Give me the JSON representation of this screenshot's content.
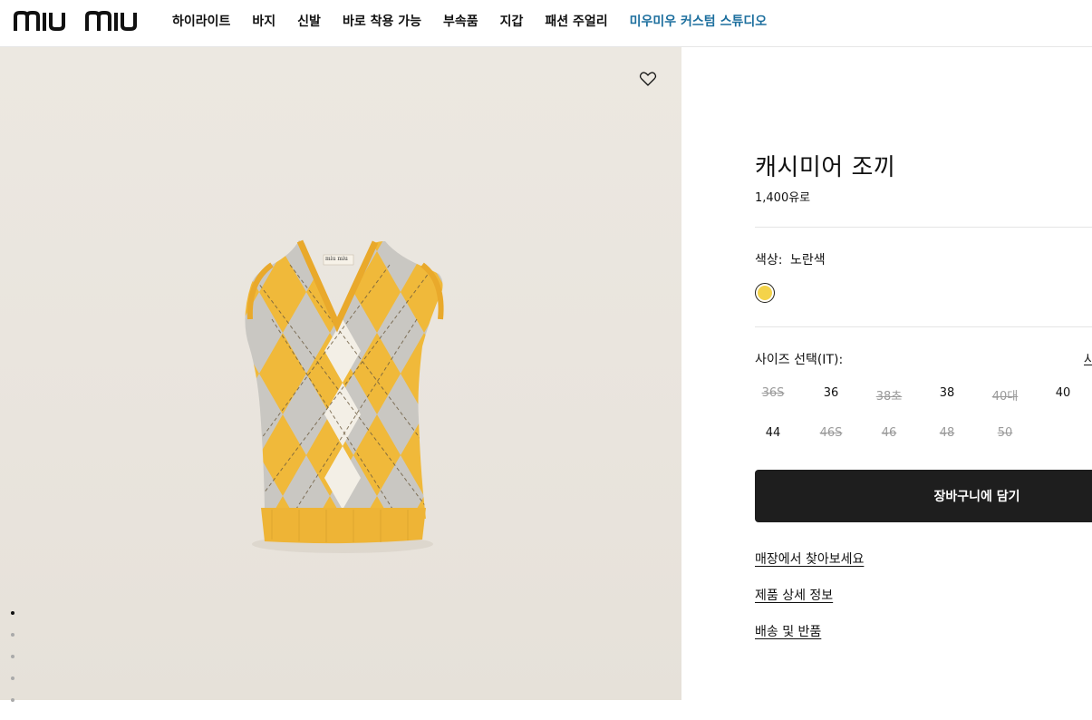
{
  "brand": {
    "logo_text": "miu miu"
  },
  "nav": {
    "items": [
      {
        "label": "하이라이트"
      },
      {
        "label": "바지"
      },
      {
        "label": "신발"
      },
      {
        "label": "바로 착용 가능"
      },
      {
        "label": "부속품"
      },
      {
        "label": "지갑"
      },
      {
        "label": "패션 주얼리"
      },
      {
        "label": "미우미우 커스텀 스튜디오",
        "accent": true
      }
    ]
  },
  "product": {
    "title": "캐시미어 조끼",
    "price": "1,400유로",
    "color_label": "색상:",
    "color_value": "노란색",
    "swatch_color": "#f4d34a",
    "size_label": "사이즈 선택(IT):",
    "size_guide": "사",
    "sizes": [
      {
        "label": "36S",
        "available": false
      },
      {
        "label": "36",
        "available": true
      },
      {
        "label": "38초",
        "available": false
      },
      {
        "label": "38",
        "available": true
      },
      {
        "label": "40대",
        "available": false
      },
      {
        "label": "40",
        "available": true
      },
      {
        "label": "44",
        "available": true
      },
      {
        "label": "46S",
        "available": false
      },
      {
        "label": "46",
        "available": false
      },
      {
        "label": "48",
        "available": false
      },
      {
        "label": "50",
        "available": false
      }
    ],
    "cart_button": "장바구니에 담기",
    "links": [
      "매장에서 찾아보세요",
      "제품 상세 정보",
      "배송 및 반품"
    ]
  },
  "media": {
    "image_label": "miu miu"
  }
}
